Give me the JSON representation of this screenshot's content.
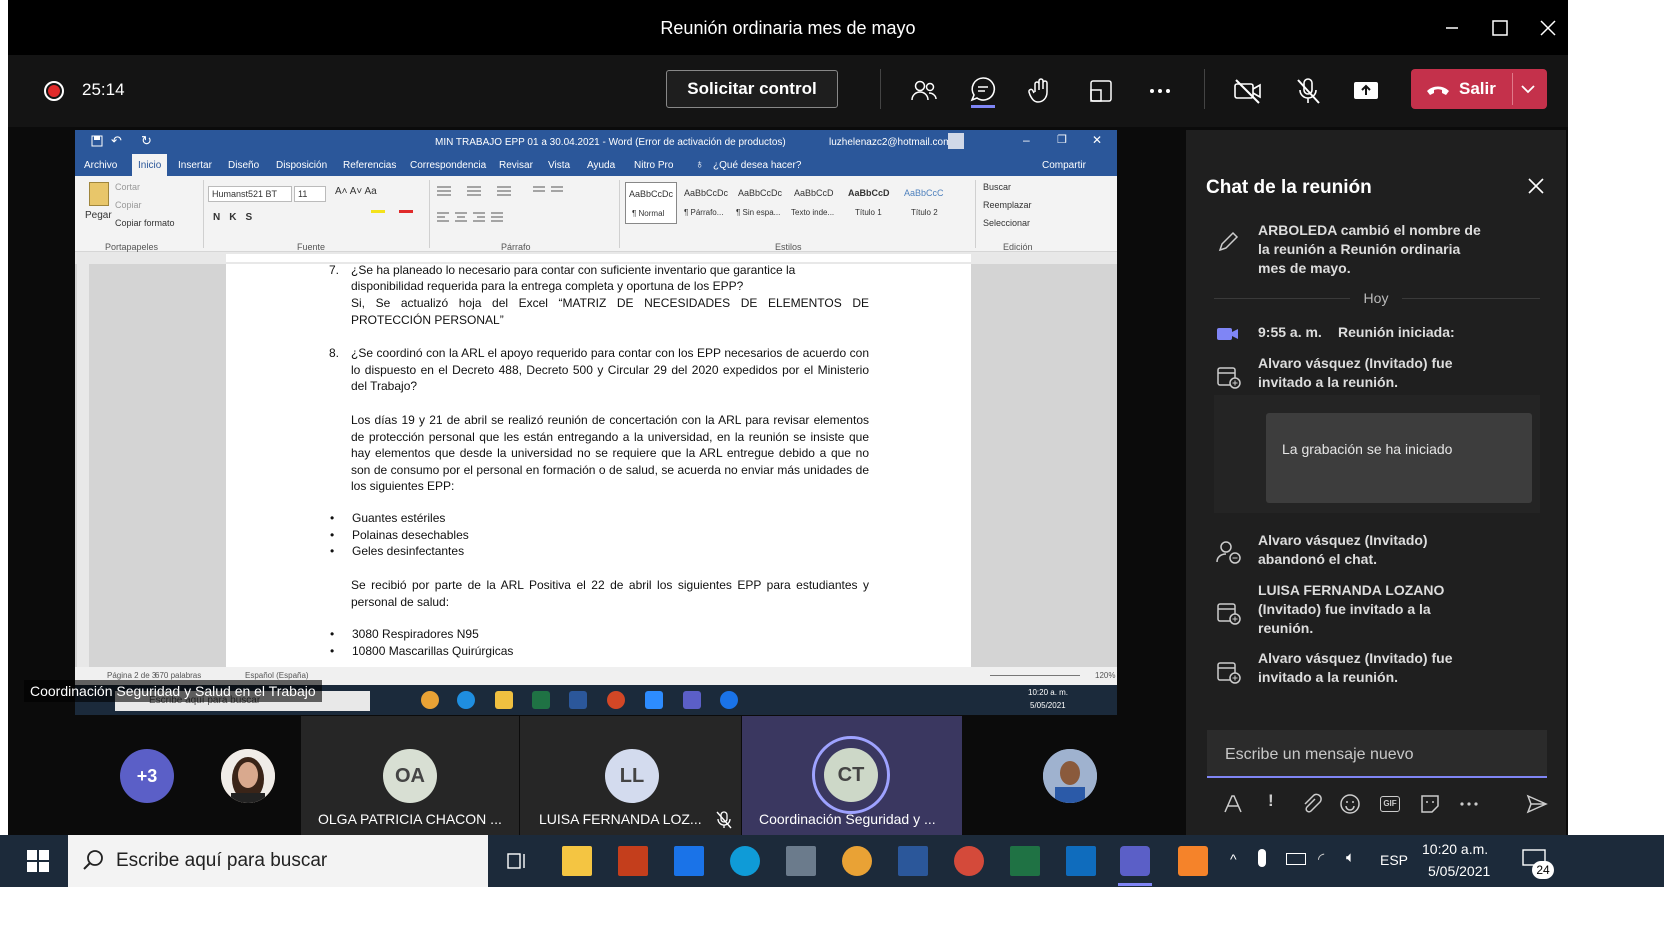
{
  "window": {
    "title": "Reunión ordinaria mes de mayo"
  },
  "toolbar": {
    "timer": "25:14",
    "request_control": "Solicitar control",
    "leave": "Salir"
  },
  "word": {
    "doc_title": "MIN TRABAJO EPP 01 a 30.04.2021  -  Word (Error de activación de productos)",
    "user_email": "luzhelenazc2@hotmail.com",
    "tabs": [
      "Archivo",
      "Inicio",
      "Insertar",
      "Diseño",
      "Disposición",
      "Referencias",
      "Correspondencia",
      "Revisar",
      "Vista",
      "Ayuda",
      "Nitro Pro",
      "¿Qué desea hacer?"
    ],
    "share": "Compartir",
    "clipboard": {
      "paste": "Pegar",
      "cut": "Cortar",
      "copy": "Copiar",
      "format": "Copiar formato",
      "group": "Portapapeles"
    },
    "font": {
      "name": "Humanst521 BT",
      "size": "11",
      "group": "Fuente"
    },
    "paragraph_group": "Párrafo",
    "styles": [
      {
        "preview": "AaBbCcDc",
        "name": "¶ Normal"
      },
      {
        "preview": "AaBbCcDc",
        "name": "¶ Párrafo..."
      },
      {
        "preview": "AaBbCcDc",
        "name": "¶ Sin espa..."
      },
      {
        "preview": "AaBbCcD",
        "name": "Texto inde..."
      },
      {
        "preview": "AaBbCcD",
        "name": "Título 1"
      },
      {
        "preview": "AaBbCcC",
        "name": "Título 2"
      }
    ],
    "styles_group": "Estilos",
    "editing": {
      "find": "Buscar",
      "replace": "Reemplazar",
      "select": "Seleccionar",
      "group": "Edición"
    },
    "doc": {
      "p1_lines": [
        "¿Se ha planeado lo necesario para contar con suficiente inventario que garantice la",
        "disponibilidad requerida para la entrega completa y oportuna de los EPP?"
      ],
      "p1_answer": "Si, Se actualizó hoja del Excel “MATRIZ DE NECESIDADES DE ELEMENTOS DE PROTECCIÓN PERSONAL”",
      "q8_num": "8.",
      "q8": "¿Se coordinó con la ARL el apoyo requerido para contar con los EPP necesarios de acuerdo con lo dispuesto en el Decreto 488, Decreto 500 y Circular 29 del 2020 expedidos por el Ministerio del Trabajo?",
      "p2": "Los días 19 y 21 de abril se realizó reunión de concertación con la ARL para revisar elementos de protección personal que les están entregando a la universidad, en la reunión se insiste que hay elementos que desde la universidad no se requiere que la ARL entregue debido a que no son de consumo por el personal en formación o de salud, se acuerda no enviar más unidades de los siguientes EPP:",
      "list1": [
        "Guantes estériles",
        "Polainas desechables",
        "Geles desinfectantes"
      ],
      "p3": "Se recibió por parte de la ARL Positiva el 22 de abril los siguientes EPP para estudiantes y personal de salud:",
      "list2": [
        "3080 Respiradores N95",
        "10800 Mascarillas Quirúrgicas"
      ]
    },
    "status": {
      "page": "Página 2 de 3",
      "words": "670 palabras",
      "lang": "Español (España)",
      "zoom": "120%"
    },
    "taskbar": {
      "search": "Escribe aquí para buscar",
      "time": "10:20 a. m.",
      "date": "5/05/2021"
    }
  },
  "presenter_label": "Coordinación Seguridad y Salud en el Trabajo",
  "chat": {
    "title": "Chat de la reunión",
    "rename": "ARBOLEDA cambió el nombre de la reunión a Reunión ordinaria mes de mayo.",
    "day": "Hoy",
    "started_time": "9:55 a. m.",
    "started": "Reunión iniciada:",
    "invite1": "Alvaro vásquez (Invitado) fue invitado a la reunión.",
    "recording": "La grabación se ha iniciado",
    "left": "Alvaro vásquez (Invitado) abandonó el chat.",
    "invite2": "LUISA FERNANDA LOZANO (Invitado) fue invitado a la reunión.",
    "invite3": "Alvaro vásquez (Invitado) fue invitado a la reunión.",
    "placeholder": "Escribe un mensaje nuevo",
    "gif": "GIF"
  },
  "participants": {
    "more": "+3",
    "p1": {
      "initials": "OA",
      "name": "OLGA PATRICIA CHACON ..."
    },
    "p2": {
      "initials": "LL",
      "name": "LUISA FERNANDA LOZ..."
    },
    "p3": {
      "initials": "CT",
      "name": "Coordinación Seguridad y ..."
    }
  },
  "taskbar": {
    "search": "Escribe aquí para buscar",
    "lang": "ESP",
    "time": "10:20 a.m.",
    "date": "5/05/2021",
    "notifications": "24"
  },
  "colors": {
    "leave": "#c4314b",
    "accent": "#7f85f5",
    "word_blue": "#2b579a"
  }
}
